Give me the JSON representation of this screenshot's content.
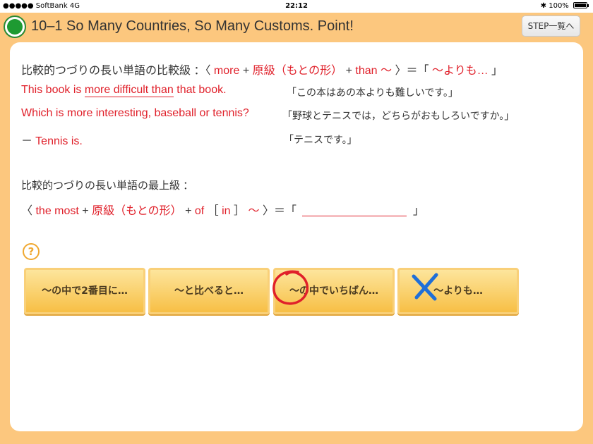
{
  "status": {
    "carrier": "●●●●● SoftBank  4G",
    "time": "22:12",
    "battery": "100%",
    "bluetooth": "✱"
  },
  "header": {
    "title": "10–1 So Many Countries, So Many Customs. Point!",
    "step_button": "STEP一覧へ"
  },
  "rule1": {
    "prefix": "比較的つづりの長い単語の比較級 ：〈",
    "more": "more",
    "plus1": "+",
    "base": "原級（もとの形）",
    "plus2": "+",
    "than": "than 〜",
    "close": "〉＝「",
    "meaning": "〜よりも…",
    "end": "」"
  },
  "example1": {
    "before": "This book is ",
    "underlined": "more difficult than",
    "after": " that book.",
    "jp": "「この本はあの本よりも難しいです。」"
  },
  "example2": {
    "en": "Which is more interesting, baseball or tennis?",
    "jp": "「野球とテニスでは，どちらがおもしろいですか。」"
  },
  "example3": {
    "dash": "－",
    "en": "Tennis is.",
    "jp": "「テニスです。」"
  },
  "rule2": {
    "heading": "比較的つづりの長い単語の最上級 ：",
    "open": "〈",
    "the_most": "the most",
    "plus1": "+",
    "base": "原級（もとの形）",
    "plus2": "+",
    "of": "of",
    "bracket_open": "［",
    "in": "in",
    "bracket_close": "］",
    "tilde": "〜",
    "close": "〉＝「",
    "end": "」"
  },
  "help_icon": "?",
  "choices": [
    {
      "label": "〜の中で2番目に…"
    },
    {
      "label": "〜と比べると…"
    },
    {
      "label": "〜の中でいちばん…"
    },
    {
      "label": "〜よりも…"
    }
  ],
  "colors": {
    "accent_red": "#e0202a",
    "header_orange": "#fcc77e",
    "button_yellow": "#f7bf45",
    "green_circle": "#1e9a32",
    "x_mark_blue": "#1f6fd8"
  }
}
